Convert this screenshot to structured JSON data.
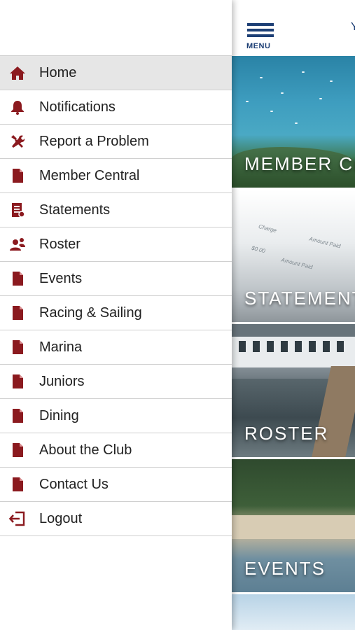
{
  "header": {
    "menu_label": "MENU",
    "title_fragment": "Y"
  },
  "tiles": [
    {
      "caption": "MEMBER CENTRAL"
    },
    {
      "caption": "STATEMENTS"
    },
    {
      "caption": "ROSTER"
    },
    {
      "caption": "EVENTS"
    }
  ],
  "statement_image_text": {
    "a": "Charge",
    "b": "Amount Paid",
    "c": "$0.00"
  },
  "drawer": {
    "items": [
      {
        "label": "Home",
        "icon": "home-icon"
      },
      {
        "label": "Notifications",
        "icon": "bell-icon"
      },
      {
        "label": "Report a Problem",
        "icon": "tools-icon"
      },
      {
        "label": "Member Central",
        "icon": "document-icon"
      },
      {
        "label": "Statements",
        "icon": "statement-icon"
      },
      {
        "label": "Roster",
        "icon": "people-icon"
      },
      {
        "label": "Events",
        "icon": "document-icon"
      },
      {
        "label": "Racing & Sailing",
        "icon": "document-icon"
      },
      {
        "label": "Marina",
        "icon": "document-icon"
      },
      {
        "label": "Juniors",
        "icon": "document-icon"
      },
      {
        "label": "Dining",
        "icon": "document-icon"
      },
      {
        "label": "About the Club",
        "icon": "document-icon"
      },
      {
        "label": "Contact Us",
        "icon": "document-icon"
      },
      {
        "label": "Logout",
        "icon": "logout-icon"
      }
    ]
  },
  "colors": {
    "accent": "#8b1a1f",
    "navy": "#1d3f75",
    "active_row": "#e6e6e6"
  }
}
